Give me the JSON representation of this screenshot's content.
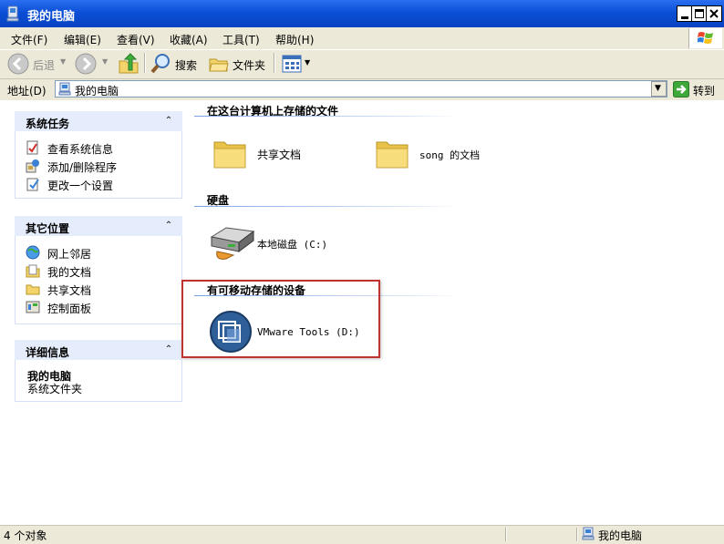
{
  "window": {
    "title": "我的电脑"
  },
  "menu": {
    "items": [
      "文件(F)",
      "编辑(E)",
      "查看(V)",
      "收藏(A)",
      "工具(T)",
      "帮助(H)"
    ]
  },
  "toolbar": {
    "back_label": "后退",
    "search_label": "搜索",
    "folders_label": "文件夹"
  },
  "address": {
    "label": "地址(D)",
    "value": "我的电脑",
    "go_label": "转到"
  },
  "sidebar": {
    "system_tasks": {
      "title": "系统任务",
      "items": [
        "查看系统信息",
        "添加/删除程序",
        "更改一个设置"
      ]
    },
    "other_places": {
      "title": "其它位置",
      "items": [
        "网上邻居",
        "我的文档",
        "共享文档",
        "控制面板"
      ]
    },
    "details": {
      "title": "详细信息",
      "name": "我的电脑",
      "type": "系统文件夹"
    }
  },
  "sections": {
    "files": {
      "title": "在这台计算机上存储的文件",
      "items": [
        "共享文档",
        "song 的文档"
      ]
    },
    "hdd": {
      "title": "硬盘",
      "items": [
        "本地磁盘 (C:)"
      ]
    },
    "removable": {
      "title": "有可移动存储的设备",
      "items": [
        "VMware Tools (D:)"
      ]
    }
  },
  "status": {
    "count": "4 个对象",
    "location": "我的电脑"
  },
  "colors": {
    "titlebar": "#0a4fd6",
    "chrome": "#ece9d8",
    "panel_header": "#e5ecfb",
    "highlight_box": "#c0322e"
  }
}
